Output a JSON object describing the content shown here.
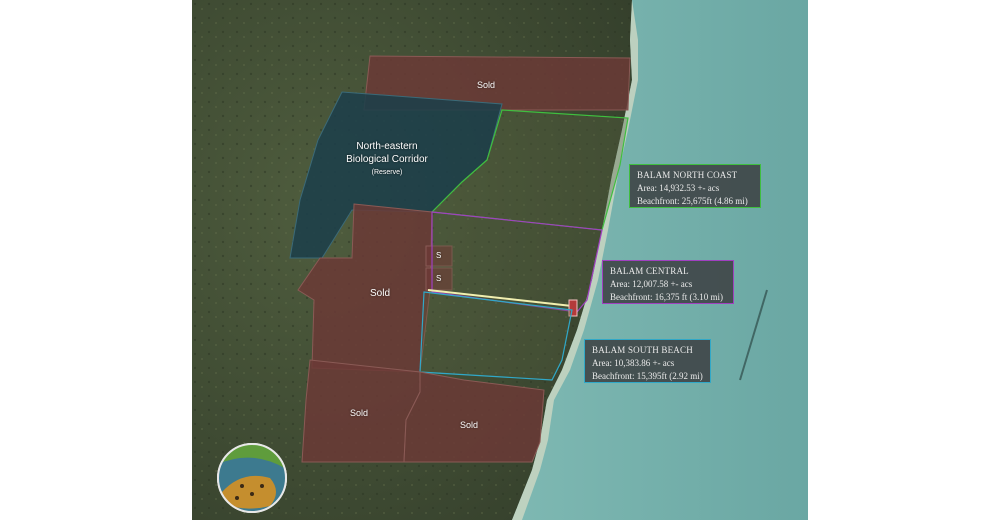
{
  "parcels": {
    "sold_north": "Sold",
    "sold_west": "Sold",
    "sold_southwest": "Sold",
    "sold_south": "Sold",
    "s_upper": "S",
    "s_lower": "S"
  },
  "reserve": {
    "name_line1": "North-eastern",
    "name_line2": "Biological Corridor",
    "note": "(Reserve)"
  },
  "balam_north": {
    "title": "BALAM NORTH COAST",
    "area": "Area: 14,932.53 +- acs",
    "beachfront": "Beachfront: 25,675ft (4.86 mi)",
    "color": "#3fbf3f"
  },
  "balam_central": {
    "title": "BALAM CENTRAL",
    "area": "Area: 12,007.58 +- acs",
    "beachfront": "Beachfront: 16,375 ft (3.10 mi)",
    "color": "#a040c0"
  },
  "balam_south": {
    "title": "BALAM SOUTH BEACH",
    "area": "Area: 10,383.86 +- acs",
    "beachfront": "Beachfront: 15,395ft (2.92 mi)",
    "color": "#30a8c8"
  },
  "logo_icon": "jaguar-badge-icon"
}
